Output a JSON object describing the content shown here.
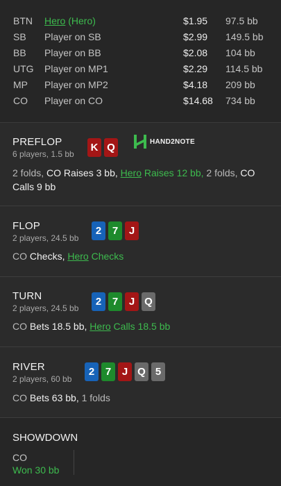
{
  "players": [
    {
      "pos": "BTN",
      "name": "Hero",
      "suffix": " (Hero)",
      "amount": "$1.95",
      "bb": "97.5 bb"
    },
    {
      "pos": "SB",
      "name": "Player on SB",
      "amount": "$2.99",
      "bb": "149.5 bb"
    },
    {
      "pos": "BB",
      "name": "Player on BB",
      "amount": "$2.08",
      "bb": "104 bb"
    },
    {
      "pos": "UTG",
      "name": "Player on MP1",
      "amount": "$2.29",
      "bb": "114.5 bb"
    },
    {
      "pos": "MP",
      "name": "Player on MP2",
      "amount": "$4.18",
      "bb": "209 bb"
    },
    {
      "pos": "CO",
      "name": "Player on CO",
      "amount": "$14.68",
      "bb": "734 bb"
    }
  ],
  "logo": {
    "text": "HAND2NOTE"
  },
  "preflop": {
    "title": "PREFLOP",
    "sub": "6 players, 1.5 bb",
    "cards": [
      {
        "r": "K",
        "c": "#a31616"
      },
      {
        "r": "Q",
        "c": "#a31616"
      }
    ],
    "a1": "2 folds, ",
    "a2": "CO",
    "a3": " Raises 3 bb, ",
    "a4": "Hero",
    "a5": " Raises 12 bb, ",
    "a6": "2 folds, ",
    "a7": "CO",
    "a8": " Calls 9 bb"
  },
  "flop": {
    "title": "FLOP",
    "sub": "2 players, 24.5 bb",
    "cards": [
      {
        "r": "2"
      },
      {
        "r": "7"
      },
      {
        "r": "J"
      }
    ],
    "a1": "CO",
    "a2": " Checks, ",
    "a3": "Hero",
    "a4": " Checks"
  },
  "turn": {
    "title": "TURN",
    "sub": "2 players, 24.5 bb",
    "cards": [
      {
        "r": "2"
      },
      {
        "r": "7"
      },
      {
        "r": "J"
      },
      {
        "r": "Q"
      }
    ],
    "a1": "CO",
    "a2": " Bets 18.5 bb, ",
    "a3": "Hero",
    "a4": " Calls 18.5 bb"
  },
  "river": {
    "title": "RIVER",
    "sub": "2 players, 60 bb",
    "cards": [
      {
        "r": "2"
      },
      {
        "r": "7"
      },
      {
        "r": "J"
      },
      {
        "r": "Q"
      },
      {
        "r": "5"
      }
    ],
    "a1": "CO",
    "a2": " Bets 63 bb, ",
    "a3": "1 folds"
  },
  "showdown": {
    "title": "SHOWDOWN",
    "player": "CO",
    "result": "Won 30 bb"
  },
  "colors": {
    "hero": "#3dbb4e",
    "spade": "#1763b8",
    "club": "#1e8a2c",
    "heart": "#a31616",
    "diamond": "#6a6a6a"
  }
}
